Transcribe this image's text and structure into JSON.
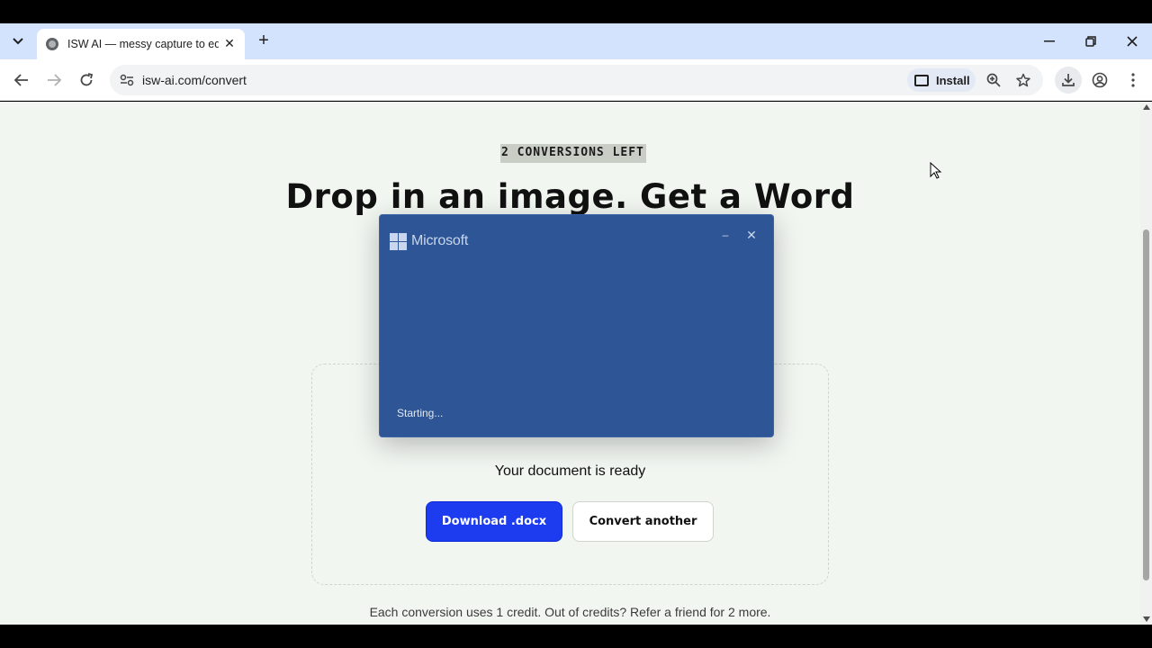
{
  "browser": {
    "tab": {
      "title": "ISW AI — messy capture to edit",
      "close_glyph": "✕"
    },
    "new_tab_glyph": "+",
    "tab_search_glyph": "⌄",
    "window_controls": {
      "minimize": "—",
      "restore": "❐",
      "close": "✕"
    },
    "nav": {
      "back": "←",
      "forward": "→",
      "reload": "↻"
    },
    "url": "isw-ai.com/convert",
    "install_label": "Install",
    "icons": [
      "zoom-icon",
      "bookmark-star-icon",
      "download-icon",
      "profile-icon",
      "menu-icon"
    ]
  },
  "page": {
    "badge": "2 CONVERSIONS LEFT",
    "headline": "Drop in an image. Get a Word",
    "status": "Your document is ready",
    "download_label": "Download .docx",
    "convert_another_label": "Convert another",
    "footnote": "Each conversion uses 1 credit. Out of credits? Refer a friend for 2 more.",
    "accent_color": "#1d3cf0"
  },
  "splash": {
    "brand": "Microsoft",
    "status": "Starting...",
    "minimize_glyph": "–",
    "close_glyph": "✕",
    "background_color": "#2e5596"
  }
}
